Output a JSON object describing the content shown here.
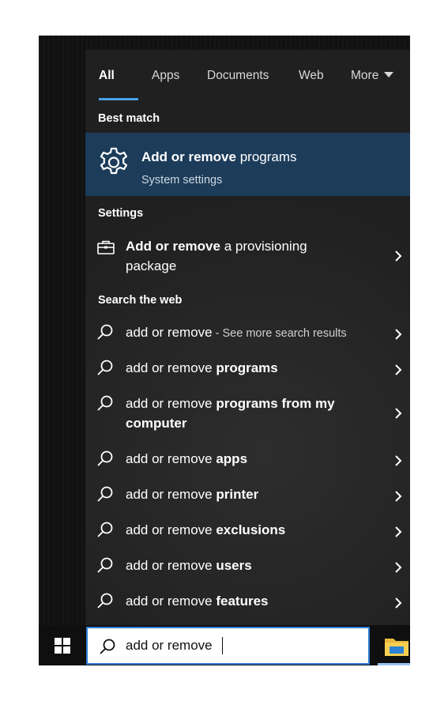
{
  "tabs": [
    {
      "label": "All",
      "active": true
    },
    {
      "label": "Apps"
    },
    {
      "label": "Documents"
    },
    {
      "label": "Web"
    },
    {
      "label": "More"
    }
  ],
  "sections": {
    "best_match": "Best match",
    "settings": "Settings",
    "search_web": "Search the web"
  },
  "best_match": {
    "title_bold": "Add or remove",
    "title_rest": " programs",
    "subtitle": "System settings",
    "icon": "gear-icon"
  },
  "settings_items": [
    {
      "bold": "Add or remove",
      "rest": " a provisioning package",
      "icon": "briefcase-icon"
    }
  ],
  "web_results": [
    {
      "query": "add or remove",
      "suffix": "",
      "hint": " - See more search results"
    },
    {
      "query": "add or remove ",
      "suffix": "programs",
      "hint": ""
    },
    {
      "query": "add or remove ",
      "suffix": "programs from my computer",
      "hint": ""
    },
    {
      "query": "add or remove ",
      "suffix": "apps",
      "hint": ""
    },
    {
      "query": "add or remove ",
      "suffix": "printer",
      "hint": ""
    },
    {
      "query": "add or remove ",
      "suffix": "exclusions",
      "hint": ""
    },
    {
      "query": "add or remove ",
      "suffix": "users",
      "hint": ""
    },
    {
      "query": "add or remove ",
      "suffix": "features",
      "hint": ""
    }
  ],
  "search": {
    "value": "add or remove",
    "icon": "search-icon"
  },
  "colors": {
    "accent": "#4aa0e6",
    "highlight": "#1c3c5a",
    "panel": "#202020",
    "search_border": "#2e7cd1"
  }
}
